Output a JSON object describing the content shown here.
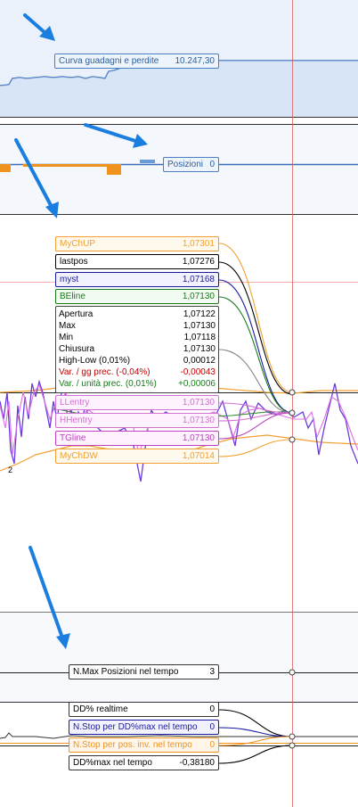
{
  "equity_panel": {
    "label": "Curva guadagni e perdite",
    "value": "10.247,30",
    "color": "#2a5fa0"
  },
  "positions_panel": {
    "label": "Posizioni",
    "value": "0",
    "bar_color": "#f0931e"
  },
  "price_panel": {
    "indicators": [
      {
        "name": "MyChUP",
        "value": "1,07301",
        "color": "#f0a030"
      },
      {
        "name": "lastpos",
        "value": "1,07276",
        "color": "#000000"
      },
      {
        "name": "myst",
        "value": "1,07168",
        "color": "#1a1aa0"
      },
      {
        "name": "BEline",
        "value": "1,07130",
        "color": "#1a7a1a"
      }
    ],
    "ohlc": [
      {
        "label": "Apertura",
        "value": "1,07122",
        "color": "#000000"
      },
      {
        "label": "Max",
        "value": "1,07130",
        "color": "#000000"
      },
      {
        "label": "Min",
        "value": "1,07118",
        "color": "#000000"
      },
      {
        "label": "Chiusura",
        "value": "1,07130",
        "color": "#000000"
      },
      {
        "label": "High-Low (0,01%)",
        "value": "0,00012",
        "color": "#000000"
      },
      {
        "label": "Var. / gg prec. (-0,04%)",
        "value": "-0,00043",
        "color": "#c00000"
      },
      {
        "label": "Var. / unità prec. (0,01%)",
        "value": "+0,00006",
        "color": "#1a7a1a"
      }
    ],
    "lower_indicators": [
      {
        "name": "LLentry",
        "value": "1,07130",
        "color": "#d070d0"
      },
      {
        "name": "HHentry",
        "value": "1,07130",
        "color": "#d070d0"
      },
      {
        "name": "TGline",
        "value": "1,07130",
        "color": "#c040c0"
      },
      {
        "name": "MyChDW",
        "value": "1,07014",
        "color": "#f0a030"
      }
    ],
    "small_label": "2"
  },
  "bottom_panel": {
    "max_positions": {
      "label": "N.Max Posizioni nel tempo",
      "value": "3"
    },
    "dd_rows": [
      {
        "label": "DD% realtime",
        "value": "0",
        "color": "#000000"
      },
      {
        "label": "N.Stop per DD%max nel tempo",
        "value": "0",
        "color": "#1a1aa0"
      },
      {
        "label": "N.Stop per pos. inv. nel tempo",
        "value": "0",
        "color": "#f0931e"
      },
      {
        "label": "DD%max nel tempo",
        "value": "-0,38180",
        "color": "#000000"
      }
    ]
  },
  "colors": {
    "cursor": "#e05050",
    "arrow": "#1a7ee0",
    "panel_bg": "#eaf1fb"
  }
}
